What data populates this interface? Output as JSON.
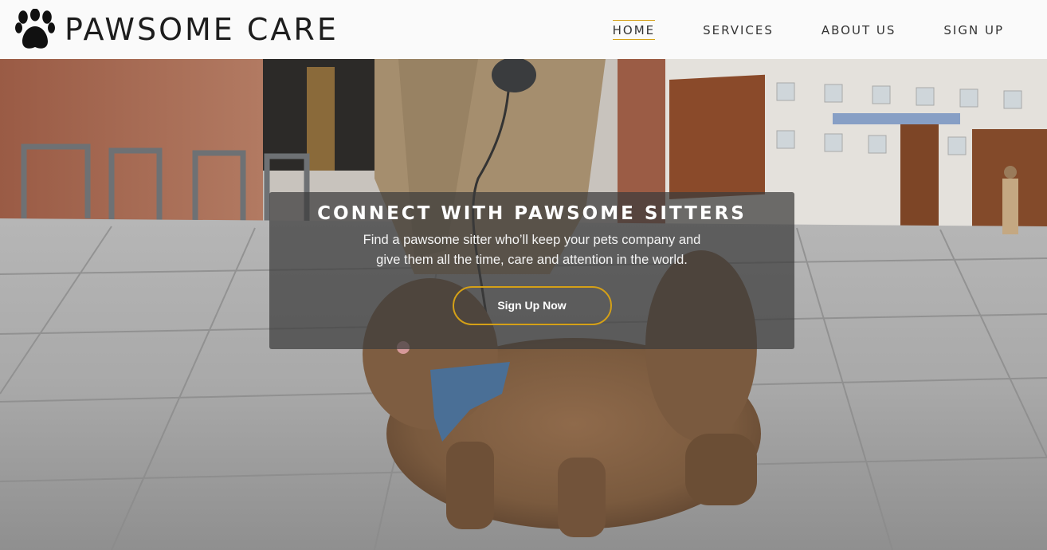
{
  "brand": {
    "name": "PAWSOME CARE",
    "logo_icon": "paw-print-icon"
  },
  "nav": {
    "items": [
      {
        "label": "HOME",
        "active": true
      },
      {
        "label": "SERVICES",
        "active": false
      },
      {
        "label": "ABOUT US",
        "active": false
      },
      {
        "label": "SIGN UP",
        "active": false
      }
    ]
  },
  "hero": {
    "title": "CONNECT WITH PAWSOME SITTERS",
    "subtitle": "Find a pawsome sitter who’ll keep your pets company and give them all the time, care and attention in the world.",
    "cta_label": "Sign Up Now",
    "background": "photo of a fluffy brown dog with a blue bandana walking on a leash on a city street"
  },
  "colors": {
    "accent": "#d4a017",
    "nav_bg": "#fafafa",
    "overlay_bg": "rgba(60,60,60,0.72)",
    "text_dark": "#1d1d1d"
  }
}
